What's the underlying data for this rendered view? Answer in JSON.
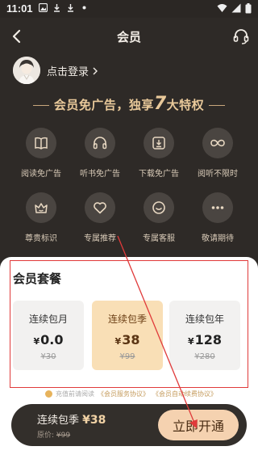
{
  "status_bar": {
    "time": "11:01"
  },
  "header": {
    "title": "会员",
    "back_icon": "chevron-left-icon",
    "support_icon": "headset-icon"
  },
  "user": {
    "login_text": "点击登录"
  },
  "headline": {
    "prefix": "会员免广告，独享",
    "number": "7",
    "suffix": "大特权"
  },
  "privileges": [
    {
      "label": "阅读免广告",
      "icon": "book-icon"
    },
    {
      "label": "听书免广告",
      "icon": "headphones-icon"
    },
    {
      "label": "下载免广告",
      "icon": "download-icon"
    },
    {
      "label": "阅听不限时",
      "icon": "infinity-icon"
    },
    {
      "label": "尊贵标识",
      "icon": "crown-badge-icon"
    },
    {
      "label": "专属推荐",
      "icon": "heart-icon"
    },
    {
      "label": "专属客服",
      "icon": "smile-icon"
    },
    {
      "label": "敬请期待",
      "icon": "more-icon"
    }
  ],
  "plans": {
    "title": "会员套餐",
    "items": [
      {
        "name": "连续包月",
        "currency": "¥",
        "price": "0.0",
        "original": "¥30"
      },
      {
        "name": "连续包季",
        "currency": "¥",
        "price": "38",
        "original": "¥99"
      },
      {
        "name": "连续包年",
        "currency": "¥",
        "price": "128",
        "original": "¥280"
      }
    ],
    "selected_index": 1
  },
  "agreement": {
    "prefix": "充值前请阅读",
    "service_link": "《会员服务协议》",
    "auto_link": "《会员自动续费协议》"
  },
  "purchase": {
    "plan_name": "连续包季",
    "price": "¥38",
    "original_label": "原价:",
    "original_price": "¥99",
    "button_label": "立即开通"
  },
  "colors": {
    "background": "#2e2a27",
    "gold": "#e9c99a",
    "selected_card": "#f9dfb6",
    "cta_button": "#f5d2b0",
    "annotation_red": "#e03a3a"
  }
}
